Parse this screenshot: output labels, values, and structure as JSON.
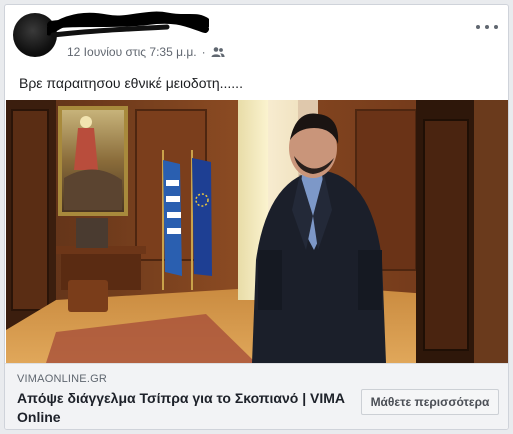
{
  "post": {
    "timestamp": "12 Ιουνίου στις 7:35 μ.μ.",
    "separator": "·",
    "audience_icon": "friends-icon",
    "more_icon": "more-options-icon",
    "text": "Βρε παραιτησου εθνικέ μειοδοτη......"
  },
  "link": {
    "domain": "VIMAONLINE.GR",
    "headline": "Απόψε διάγγελμα Τσίπρα για το Σκοπιανό | VIMA Online",
    "cta_label": "Μάθετε περισσότερα"
  },
  "colors": {
    "card_bg": "#ffffff",
    "footer_bg": "#f2f3f5",
    "meta_text": "#616770",
    "headline_text": "#1d2129"
  }
}
